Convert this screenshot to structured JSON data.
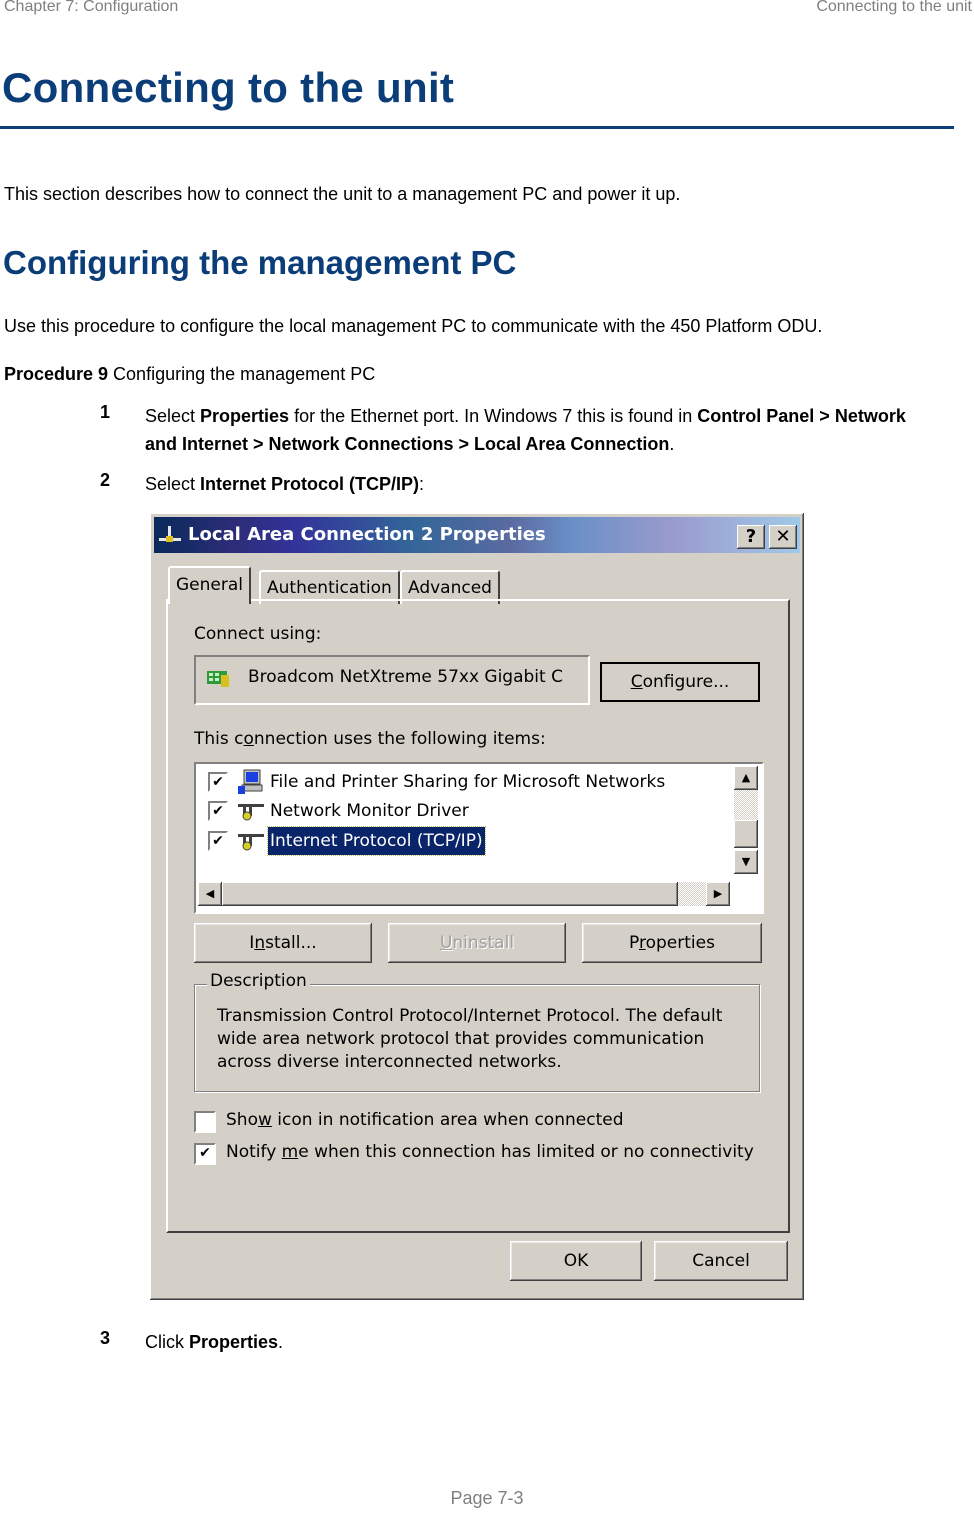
{
  "header": {
    "chapter": "Chapter 7:  Configuration",
    "section": "Connecting to the unit"
  },
  "title": "Connecting to the unit",
  "intro": "This section describes how to connect the unit to a management PC and power it up.",
  "subheading": "Configuring the management PC",
  "sub_intro": "Use this procedure to configure the local management PC to communicate with the 450 Platform ODU.",
  "procedure": {
    "label": "Procedure 9",
    "title": " Configuring the management PC"
  },
  "steps": [
    {
      "num": "1",
      "parts": [
        "Select ",
        "Properties",
        " for the Ethernet port. In Windows 7 this is found in ",
        "Control Panel > Network and Internet > Network Connections > Local Area Connection",
        "."
      ]
    },
    {
      "num": "2",
      "parts": [
        "Select ",
        "Internet Protocol (TCP/IP)",
        ":"
      ]
    },
    {
      "num": "3",
      "parts": [
        "Click ",
        "Properties",
        "."
      ]
    }
  ],
  "dialog": {
    "title": "Local Area Connection 2 Properties",
    "help_button": "?",
    "close_button": "✕",
    "tabs": [
      "General",
      "Authentication",
      "Advanced"
    ],
    "active_tab": "General",
    "connect_using_label": "Connect using:",
    "adapter_name": "Broadcom NetXtreme 57xx Gigabit C",
    "configure_button": {
      "pre": "",
      "ul": "C",
      "post": "onfigure..."
    },
    "items_label": {
      "pre": "This c",
      "ul": "o",
      "post": "nnection uses the following items:"
    },
    "items": [
      {
        "label": "File and Printer Sharing for Microsoft Networks",
        "checked": true,
        "icon": "computer-icon",
        "selected": false
      },
      {
        "label": "Network Monitor Driver",
        "checked": true,
        "icon": "network-protocol-icon",
        "selected": false
      },
      {
        "label": "Internet Protocol (TCP/IP)",
        "checked": true,
        "icon": "network-protocol-icon",
        "selected": true
      }
    ],
    "install_button": {
      "pre": "I",
      "ul": "n",
      "post": "stall..."
    },
    "uninstall_button": {
      "pre": "",
      "ul": "U",
      "post": "ninstall"
    },
    "properties_button": {
      "pre": "P",
      "ul": "r",
      "post": "operties"
    },
    "description_legend": "Description",
    "description_text": "Transmission Control Protocol/Internet Protocol. The default wide area network protocol that provides communication across diverse interconnected networks.",
    "show_icon_option": {
      "pre": "Sho",
      "ul": "w",
      "post": " icon in notification area when connected",
      "checked": false
    },
    "notify_option": {
      "pre": "Notify ",
      "ul": "m",
      "post": "e when this connection has limited or no connectivity",
      "checked": true
    },
    "ok_button": "OK",
    "cancel_button": "Cancel",
    "check_glyph": "✔"
  },
  "footer": {
    "page": "Page 7-3"
  }
}
